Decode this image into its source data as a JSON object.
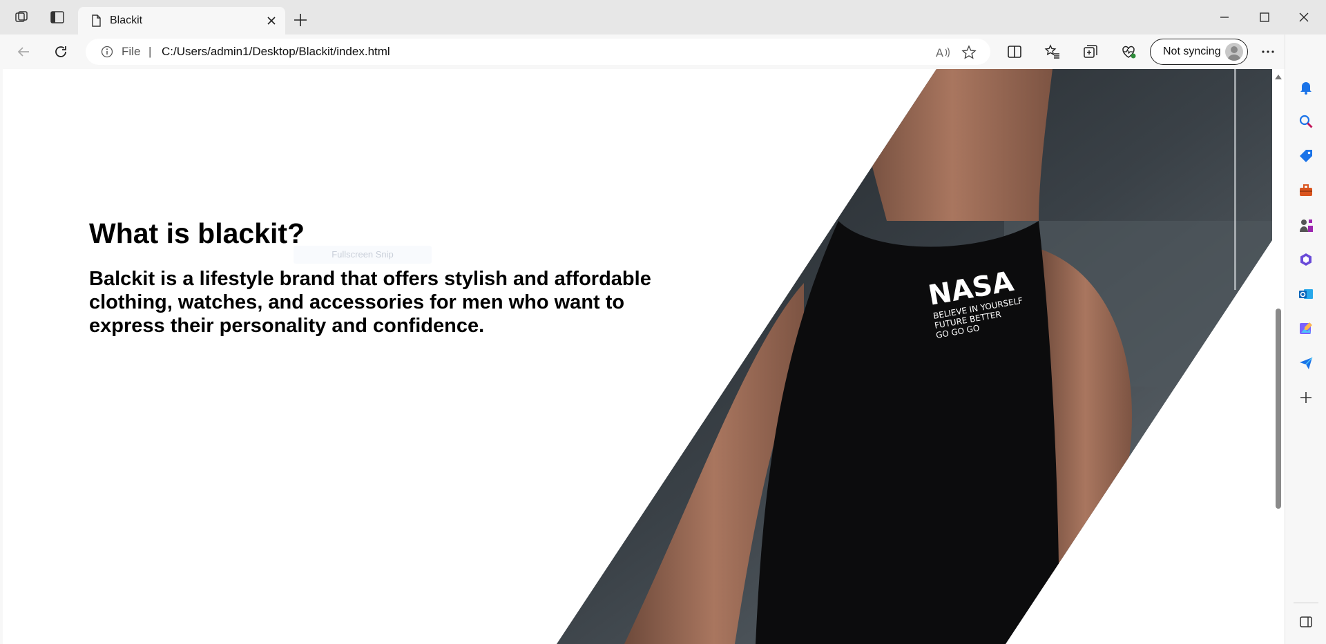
{
  "browser": {
    "tab_title": "Blackit",
    "address_scheme": "File",
    "address_separator": "|",
    "url": "C:/Users/admin1/Desktop/Blackit/index.html",
    "sync_label": "Not syncing"
  },
  "page": {
    "heading": "What is blackit?",
    "description": "Balckit is a lifestyle brand that offers stylish and affordable clothing, watches, and accessories for men who want to express their personality and confidence.",
    "fullscreen_tip": "Fullscreen Snip",
    "shirt_logo": "NASA",
    "shirt_lines": [
      "BELIEVE IN YOURSELF",
      "FUTURE BETTER",
      "GO GO GO"
    ]
  },
  "colors": {
    "page_bg": "#ffffff",
    "text": "#000000",
    "chrome_bg": "#f7f7f7",
    "titlebar_bg": "#e7e7e7"
  },
  "icons": {
    "workspaces": "workspaces-icon",
    "tab_actions": "tab-actions-icon",
    "page": "page-icon",
    "close": "close-icon",
    "new_tab": "plus-icon",
    "minimize": "minimize-icon",
    "maximize": "maximize-icon",
    "window_close": "window-close-icon",
    "back": "back-arrow-icon",
    "refresh": "refresh-icon",
    "info": "info-icon",
    "read_aloud": "read-aloud-icon",
    "favorite": "star-icon",
    "split_screen": "split-screen-icon",
    "favorites": "favorites-icon",
    "collections": "collections-icon",
    "browser_essentials": "heart-pulse-icon",
    "more": "more-icon",
    "copilot": "copilot-icon"
  }
}
